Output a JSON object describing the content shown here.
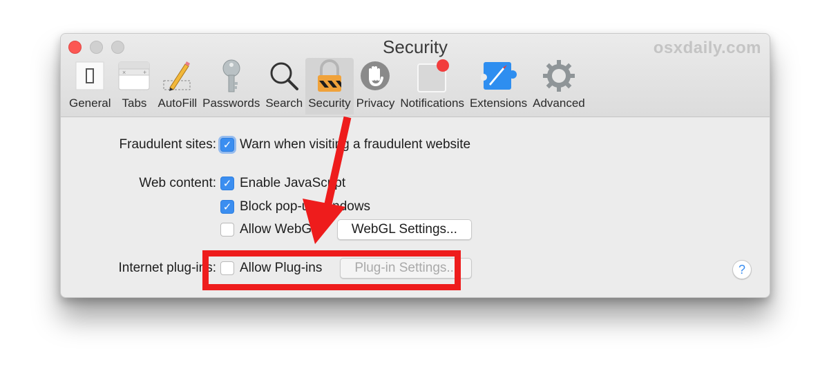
{
  "window": {
    "title": "Security",
    "watermark": "osxdaily.com"
  },
  "toolbar": {
    "tabs": [
      {
        "label": "General",
        "icon": "general-switch-icon",
        "active": false
      },
      {
        "label": "Tabs",
        "icon": "tabs-icon",
        "active": false
      },
      {
        "label": "AutoFill",
        "icon": "pencil-icon",
        "active": false
      },
      {
        "label": "Passwords",
        "icon": "key-icon",
        "active": false
      },
      {
        "label": "Search",
        "icon": "magnifier-icon",
        "active": false
      },
      {
        "label": "Security",
        "icon": "padlock-icon",
        "active": true
      },
      {
        "label": "Privacy",
        "icon": "hand-icon",
        "active": false
      },
      {
        "label": "Notifications",
        "icon": "notification-badge-icon",
        "active": false
      },
      {
        "label": "Extensions",
        "icon": "compass-puzzle-icon",
        "active": false
      },
      {
        "label": "Advanced",
        "icon": "gear-icon",
        "active": false
      }
    ]
  },
  "settings": {
    "fraudulent": {
      "label": "Fraudulent sites:",
      "option": "Warn when visiting a fraudulent website",
      "checked": true
    },
    "web_content": {
      "label": "Web content:",
      "options": [
        {
          "text": "Enable JavaScript",
          "checked": true
        },
        {
          "text": "Block pop-up windows",
          "checked": true
        },
        {
          "text": "Allow WebGL",
          "checked": false
        }
      ],
      "webgl_button": "WebGL Settings..."
    },
    "plugins": {
      "label": "Internet plug-ins:",
      "option": "Allow Plug-ins",
      "checked": false,
      "button": "Plug-in Settings..."
    },
    "help": "?"
  },
  "annotation": {
    "color": "#ee1c1c"
  }
}
